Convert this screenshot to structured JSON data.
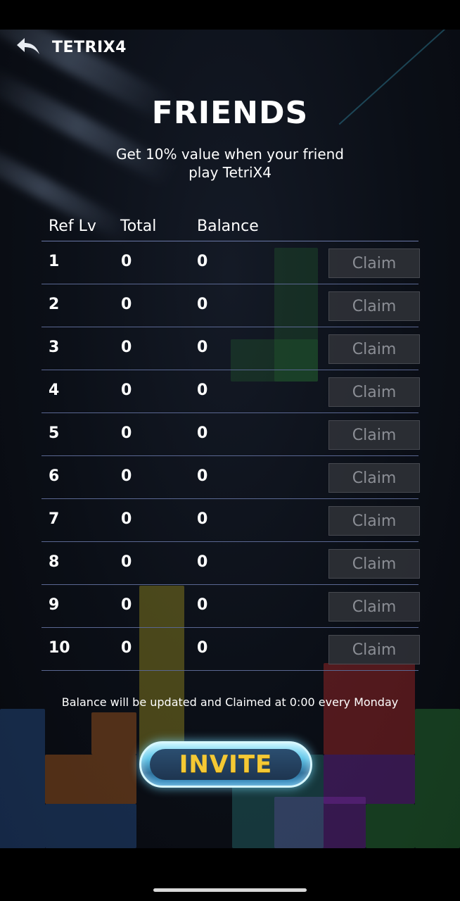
{
  "header": {
    "app_title": "TETRIX4",
    "back_icon": "curved-back-arrow-icon"
  },
  "page": {
    "title": "FRIENDS",
    "subtitle_line1": "Get 10% value when your friend",
    "subtitle_line2": "play TetriX4"
  },
  "table": {
    "columns": [
      "Ref Lv",
      "Total",
      "Balance"
    ],
    "rows": [
      {
        "level": "1",
        "total": "0",
        "balance": "0",
        "action": "Claim"
      },
      {
        "level": "2",
        "total": "0",
        "balance": "0",
        "action": "Claim"
      },
      {
        "level": "3",
        "total": "0",
        "balance": "0",
        "action": "Claim"
      },
      {
        "level": "4",
        "total": "0",
        "balance": "0",
        "action": "Claim"
      },
      {
        "level": "5",
        "total": "0",
        "balance": "0",
        "action": "Claim"
      },
      {
        "level": "6",
        "total": "0",
        "balance": "0",
        "action": "Claim"
      },
      {
        "level": "7",
        "total": "0",
        "balance": "0",
        "action": "Claim"
      },
      {
        "level": "8",
        "total": "0",
        "balance": "0",
        "action": "Claim"
      },
      {
        "level": "9",
        "total": "0",
        "balance": "0",
        "action": "Claim"
      },
      {
        "level": "10",
        "total": "0",
        "balance": "0",
        "action": "Claim"
      }
    ]
  },
  "notice": "Balance will be updated and Claimed at 0:00 every Monday",
  "invite": {
    "label": "INVITE"
  },
  "colors": {
    "accent_gold": "#f5c934",
    "invite_glow": "#5fc6ea",
    "divider": "#5a6792",
    "claim_disabled_text": "#8b8e95"
  }
}
